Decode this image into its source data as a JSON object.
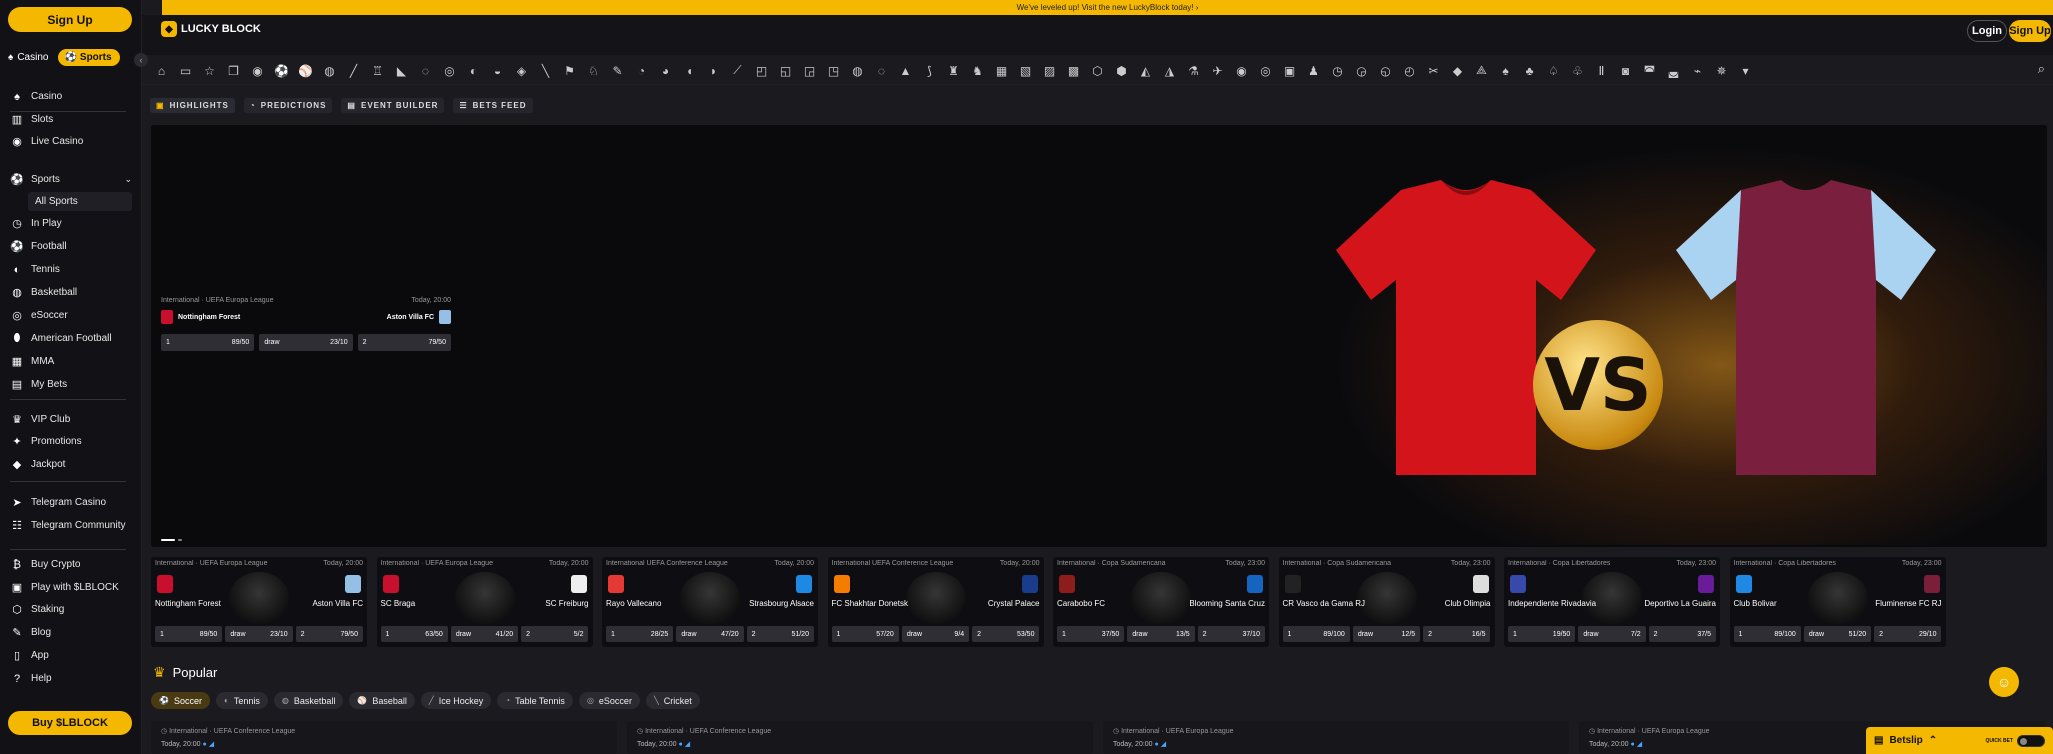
{
  "banner": {
    "text": "We've leveled up! Visit the new LuckyBlock today! ›"
  },
  "brand": {
    "name": "LUCKY BLOCK",
    "accent": "#f5b800"
  },
  "header": {
    "login": "Login",
    "signup": "Sign Up"
  },
  "sidebar": {
    "signup": "Sign Up",
    "switch": {
      "casino": "Casino",
      "sports": "Sports"
    },
    "items": [
      {
        "label": "Casino",
        "icon": "casino-icon"
      },
      {
        "label": "Slots",
        "icon": "slots-icon"
      },
      {
        "label": "Live Casino",
        "icon": "live-casino-icon"
      },
      {
        "label": "Sports",
        "icon": "sports-icon"
      },
      {
        "label": "All Sports",
        "icon": ""
      },
      {
        "label": "In Play",
        "icon": "in-play-icon"
      },
      {
        "label": "Football",
        "icon": "football-icon"
      },
      {
        "label": "Tennis",
        "icon": "tennis-icon"
      },
      {
        "label": "Basketball",
        "icon": "basketball-icon"
      },
      {
        "label": "eSoccer",
        "icon": "esoccer-icon"
      },
      {
        "label": "American Football",
        "icon": "american-football-icon"
      },
      {
        "label": "MMA",
        "icon": "mma-icon"
      },
      {
        "label": "My Bets",
        "icon": "my-bets-icon"
      },
      {
        "label": "VIP Club",
        "icon": "vip-icon"
      },
      {
        "label": "Promotions",
        "icon": "promotions-icon"
      },
      {
        "label": "Jackpot",
        "icon": "jackpot-icon"
      },
      {
        "label": "Telegram Casino",
        "icon": "telegram-icon"
      },
      {
        "label": "Telegram Community",
        "icon": "community-icon"
      },
      {
        "label": "Buy Crypto",
        "icon": "buy-crypto-icon"
      },
      {
        "label": "Play with $LBLOCK",
        "icon": "lblock-icon"
      },
      {
        "label": "Staking",
        "icon": "staking-icon"
      },
      {
        "label": "Blog",
        "icon": "blog-icon"
      },
      {
        "label": "App",
        "icon": "app-icon"
      },
      {
        "label": "Help",
        "icon": "help-icon"
      }
    ],
    "buy": "Buy $LBLOCK"
  },
  "tabs": [
    "HIGHLIGHTS",
    "PREDICTIONS",
    "EVENT BUILDER",
    "BETS FEED"
  ],
  "hero_match": {
    "league": "International · UEFA Europa League",
    "time": "Today, 20:00",
    "home": "Nottingham Forest",
    "away": "Aston Villa FC",
    "odds": [
      [
        "1",
        "89/50"
      ],
      [
        "draw",
        "23/10"
      ],
      [
        "2",
        "79/50"
      ]
    ]
  },
  "cards": [
    {
      "league": "International · UEFA Europa League",
      "time": "Today, 20:00",
      "home": "Nottingham Forest",
      "away": "Aston Villa FC",
      "hc": "#c8102e",
      "ac": "#95bfe5",
      "odds": [
        [
          "1",
          "89/50"
        ],
        [
          "draw",
          "23/10"
        ],
        [
          "2",
          "79/50"
        ]
      ]
    },
    {
      "league": "International · UEFA Europa League",
      "time": "Today, 20:00",
      "home": "SC Braga",
      "away": "SC Freiburg",
      "hc": "#c8102e",
      "ac": "#eeeeee",
      "odds": [
        [
          "1",
          "63/50"
        ],
        [
          "draw",
          "41/20"
        ],
        [
          "2",
          "5/2"
        ]
      ]
    },
    {
      "league": "International UEFA Conference League",
      "time": "Today, 20:00",
      "home": "Rayo Vallecano",
      "away": "Strasbourg Alsace",
      "hc": "#e53935",
      "ac": "#1e88e5",
      "odds": [
        [
          "1",
          "28/25"
        ],
        [
          "draw",
          "47/20"
        ],
        [
          "2",
          "51/20"
        ]
      ]
    },
    {
      "league": "International UEFA Conference League",
      "time": "Today, 20:00",
      "home": "FC Shakhtar Donetsk",
      "away": "Crystal Palace",
      "hc": "#f57c00",
      "ac": "#1b3c8c",
      "odds": [
        [
          "1",
          "57/20"
        ],
        [
          "draw",
          "9/4"
        ],
        [
          "2",
          "53/50"
        ]
      ]
    },
    {
      "league": "International · Copa Sudamericana",
      "time": "Today, 23:00",
      "home": "Carabobo FC",
      "away": "Blooming Santa Cruz",
      "hc": "#8d1c1c",
      "ac": "#1565c0",
      "odds": [
        [
          "1",
          "37/50"
        ],
        [
          "draw",
          "13/5"
        ],
        [
          "2",
          "37/10"
        ]
      ]
    },
    {
      "league": "International · Copa Sudamericana",
      "time": "Today, 23:00",
      "home": "CR Vasco da Gama RJ",
      "away": "Club Olimpia",
      "hc": "#222222",
      "ac": "#dddddd",
      "odds": [
        [
          "1",
          "89/100"
        ],
        [
          "draw",
          "12/5"
        ],
        [
          "2",
          "16/5"
        ]
      ]
    },
    {
      "league": "International · Copa Libertadores",
      "time": "Today, 23:00",
      "home": "Independiente Rivadavia",
      "away": "Deportivo La Guaira",
      "hc": "#3949ab",
      "ac": "#6a1b9a",
      "odds": [
        [
          "1",
          "19/50"
        ],
        [
          "draw",
          "7/2"
        ],
        [
          "2",
          "37/5"
        ]
      ]
    },
    {
      "league": "International · Copa Libertadores",
      "time": "Today, 23:00",
      "home": "Club Bolivar",
      "away": "Fluminense FC RJ",
      "hc": "#1e88e5",
      "ac": "#7b1e3a",
      "odds": [
        [
          "1",
          "89/100"
        ],
        [
          "draw",
          "51/20"
        ],
        [
          "2",
          "29/10"
        ]
      ]
    }
  ],
  "popular": {
    "title": "Popular",
    "tabs": [
      "Soccer",
      "Tennis",
      "Basketball",
      "Baseball",
      "Ice Hockey",
      "Table Tennis",
      "eSoccer",
      "Cricket"
    ]
  },
  "lists": [
    {
      "league": "International · UEFA Conference League",
      "time": "Today, 20:00"
    },
    {
      "league": "International · UEFA Conference League",
      "time": "Today, 20:00"
    },
    {
      "league": "International · UEFA Europa League",
      "time": "Today, 20:00"
    },
    {
      "league": "International · UEFA Europa League",
      "time": "Today, 20:00"
    }
  ],
  "betslip": {
    "label": "Betslip",
    "quick": "QUICK BET"
  }
}
